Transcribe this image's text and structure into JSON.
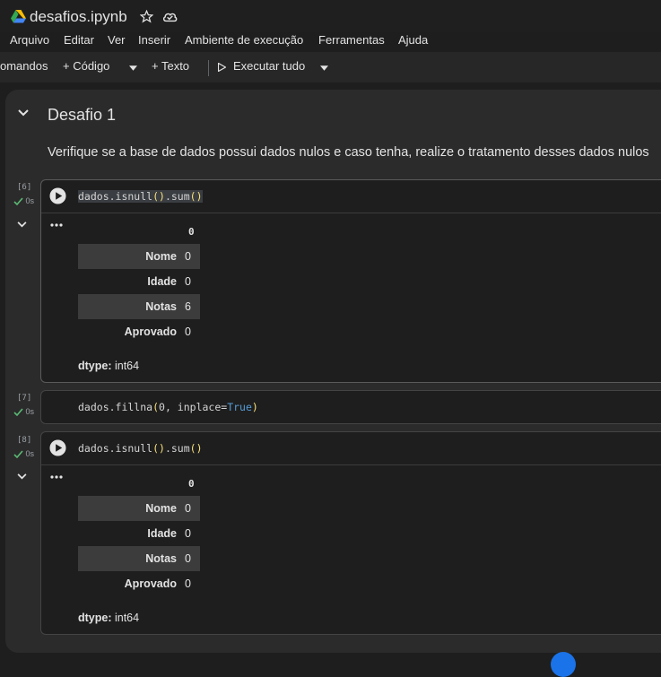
{
  "doc": {
    "title": "desafios.ipynb"
  },
  "menu": [
    "Arquivo",
    "Editar",
    "Ver",
    "Inserir",
    "Ambiente de execução",
    "Ferramentas",
    "Ajuda"
  ],
  "toolbar": {
    "commands": "omandos",
    "add_code": "+ Código",
    "add_text": "+ Texto",
    "run_all": "Executar tudo"
  },
  "section": {
    "title": "Desafio 1",
    "text": "Verifique se a base de dados possui dados nulos e caso tenha, realize o tratamento desses dados nulos"
  },
  "cells": [
    {
      "exec_count": "[6]",
      "status": "0s",
      "code": {
        "obj": "dados.isnull",
        "p1": "()",
        "mid": ".sum",
        "p2": "()"
      },
      "output": {
        "header": "0",
        "rows": [
          {
            "name": "Nome",
            "value": "0"
          },
          {
            "name": "Idade",
            "value": "0"
          },
          {
            "name": "Notas",
            "value": "6"
          },
          {
            "name": "Aprovado",
            "value": "0"
          }
        ],
        "dtype_label": "dtype:",
        "dtype_value": " int64"
      }
    },
    {
      "exec_count": "[7]",
      "status": "0s",
      "code": {
        "a": "dados.fillna",
        "p_open": "(",
        "b": "0, inplace=",
        "kw": "True",
        "p_close": ")"
      }
    },
    {
      "exec_count": "[8]",
      "status": "0s",
      "code": {
        "obj": "dados.isnull",
        "p1": "()",
        "mid": ".sum",
        "p2": "()"
      },
      "output": {
        "header": "0",
        "rows": [
          {
            "name": "Nome",
            "value": "0"
          },
          {
            "name": "Idade",
            "value": "0"
          },
          {
            "name": "Notas",
            "value": "0"
          },
          {
            "name": "Aprovado",
            "value": "0"
          }
        ],
        "dtype_label": "dtype:",
        "dtype_value": " int64"
      }
    }
  ],
  "colors": {
    "accent_check": "#5bb974",
    "paren": "#f9e07a",
    "keyword": "#569cd6",
    "fab": "#1a73e8"
  }
}
